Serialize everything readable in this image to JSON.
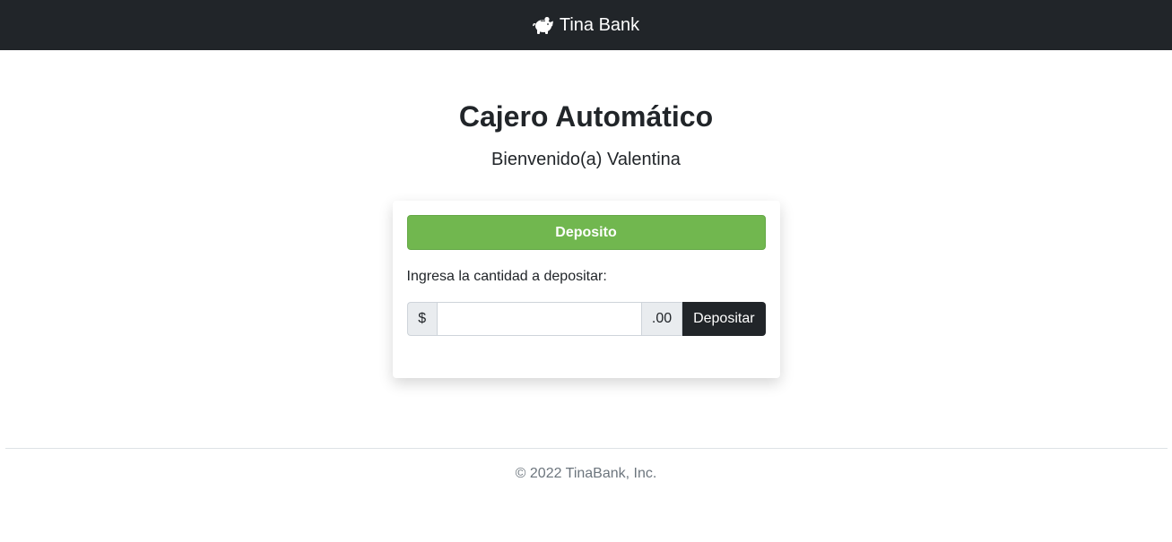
{
  "navbar": {
    "brand_name": "Tina Bank",
    "brand_icon": "piggy-bank-icon"
  },
  "main": {
    "title": "Cajero Automático",
    "welcome": "Bienvenido(a) Valentina"
  },
  "deposit_card": {
    "header_label": "Deposito",
    "amount_label": "Ingresa la cantidad a depositar:",
    "currency_prefix": "$",
    "decimal_suffix": ".00",
    "amount_value": "",
    "submit_label": "Depositar"
  },
  "footer": {
    "copyright": "© 2022 TinaBank, Inc."
  },
  "colors": {
    "navbar_bg": "#212529",
    "deposit_header_bg": "#71b74f",
    "submit_bg": "#212529",
    "footer_text": "#6c757d"
  }
}
